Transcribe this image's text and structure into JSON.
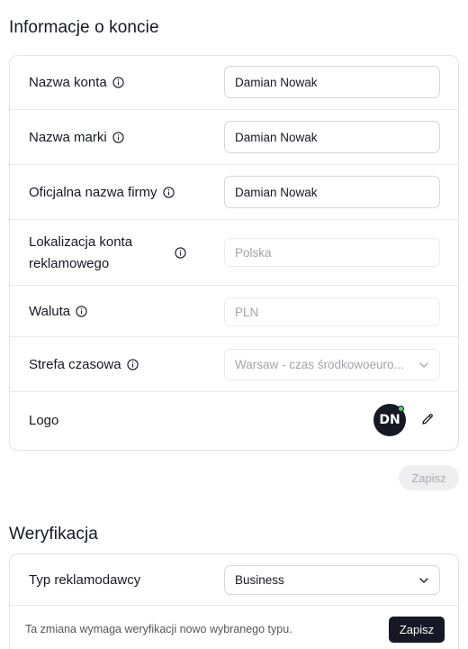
{
  "account_section": {
    "title": "Informacje o koncie",
    "rows": [
      {
        "label": "Nazwa konta",
        "value": "Damian Nowak"
      },
      {
        "label": "Nazwa marki",
        "value": "Damian Nowak"
      },
      {
        "label": "Oficjalna nazwa firmy",
        "value": "Damian Nowak"
      },
      {
        "label_line1": "Lokalizacja konta",
        "label_line2": "reklamowego",
        "value": "Polska"
      },
      {
        "label": "Waluta",
        "value": "PLN"
      },
      {
        "label": "Strefa czasowa",
        "value": "Warsaw - czas środkowoeuro..."
      },
      {
        "label": "Logo",
        "avatar_initials": "DN"
      }
    ],
    "save_label": "Zapisz"
  },
  "verification_section": {
    "title": "Weryfikacja",
    "advertiser_type_label": "Typ reklamodawcy",
    "advertiser_type_value": "Business",
    "note": "Ta zmiana wymaga weryfikacji nowo wybranego typu.",
    "save_label": "Zapisz"
  },
  "icons": {
    "info": "info-circle-icon",
    "chevron": "chevron-down-icon",
    "edit": "pencil-icon",
    "online_status": "green-status-dot"
  },
  "colors": {
    "text": "#161823",
    "muted_text": "#a4a4aa",
    "border": "#e3e3e6",
    "dark_button": "#161823",
    "status_green": "#4ad66d"
  }
}
